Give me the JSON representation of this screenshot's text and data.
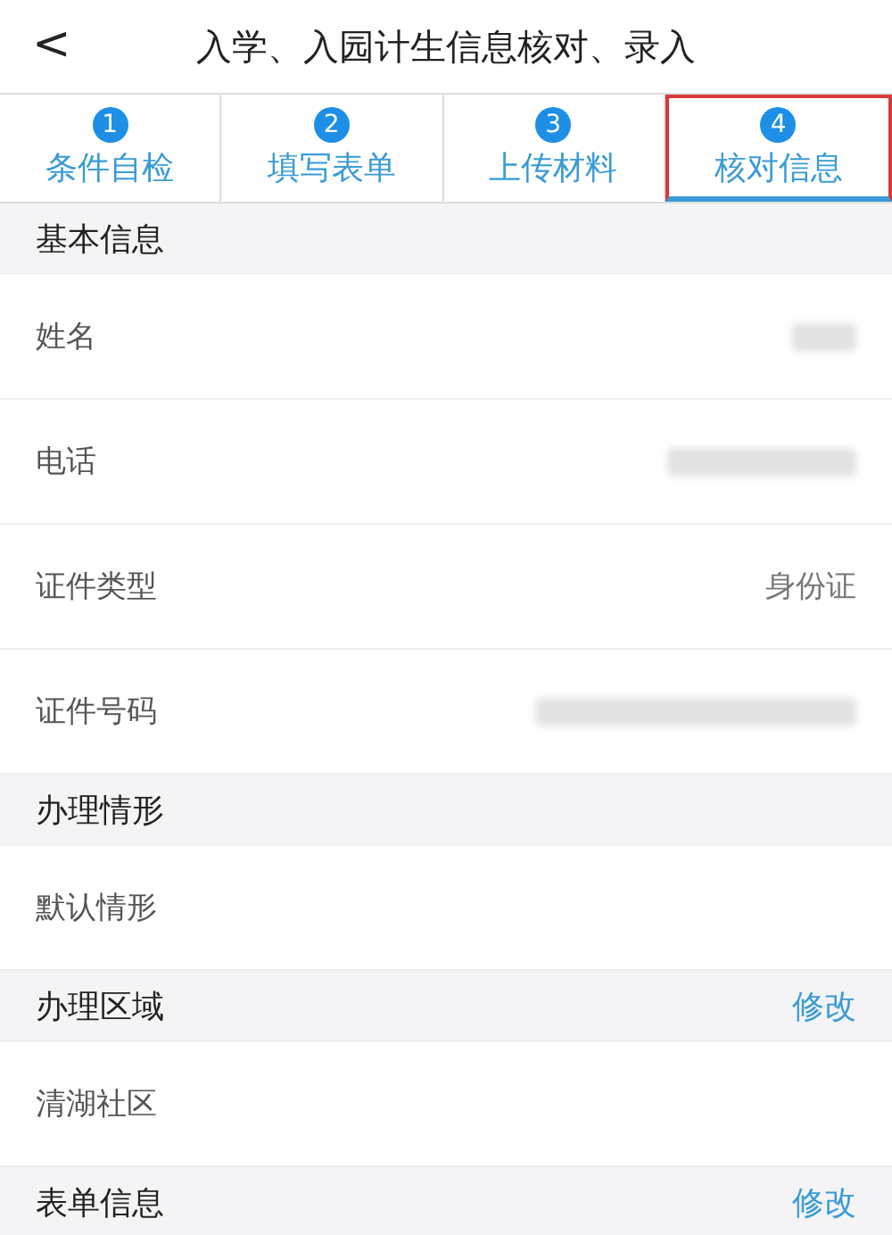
{
  "header": {
    "back": "<",
    "title": "入学、入园计生信息核对、录入"
  },
  "tabs": [
    {
      "number": "1",
      "label": "条件自检",
      "selected": false
    },
    {
      "number": "2",
      "label": "填写表单",
      "selected": false
    },
    {
      "number": "3",
      "label": "上传材料",
      "selected": false
    },
    {
      "number": "4",
      "label": "核对信息",
      "selected": true
    }
  ],
  "sections": [
    {
      "title": "基本信息",
      "rows": [
        {
          "label": "姓名",
          "redacted": true
        },
        {
          "label": "电话",
          "redacted": true
        },
        {
          "label": "证件类型",
          "value": "身份证"
        },
        {
          "label": "证件号码",
          "redacted": true
        }
      ]
    },
    {
      "title": "办理情形",
      "rows": [
        {
          "label": "默认情形"
        }
      ]
    },
    {
      "title": "办理区域",
      "action": "修改",
      "rows": [
        {
          "label": "清湖社区"
        }
      ]
    },
    {
      "title": "表单信息",
      "action": "修改"
    }
  ]
}
